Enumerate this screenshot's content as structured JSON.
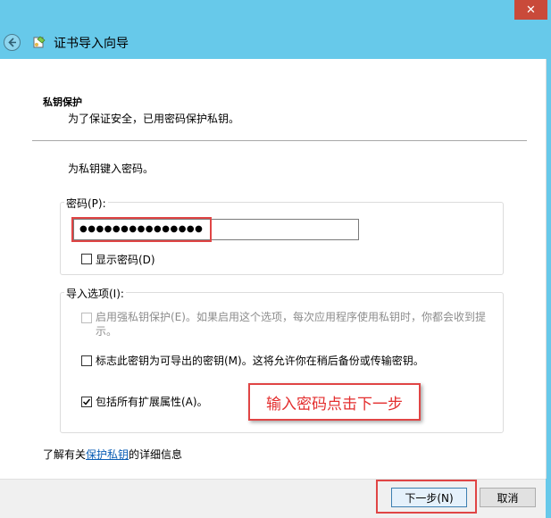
{
  "window": {
    "close_glyph": "✕",
    "title": "证书导入向导",
    "back_icon": "back-arrow-icon",
    "wizard_icon": "certificate-wizard-icon"
  },
  "section": {
    "heading": "私钥保护",
    "description": "为了保证安全，已用密码保护私钥。"
  },
  "prompt": "为私钥键入密码。",
  "password": {
    "label": "密码(P):",
    "value": "●●●●●●●●●●●●●●●",
    "show_label": "显示密码(D)",
    "show_checked": false
  },
  "import_options": {
    "label": "导入选项(I):",
    "options": [
      {
        "label": "启用强私钥保护(E)。如果启用这个选项，每次应用程序使用私钥时，你都会收到提示。",
        "checked": false,
        "enabled": false
      },
      {
        "label": "标志此密钥为可导出的密钥(M)。这将允许你在稍后备份或传输密钥。",
        "checked": false,
        "enabled": true
      },
      {
        "label": "包括所有扩展属性(A)。",
        "checked": true,
        "enabled": true
      }
    ]
  },
  "annotation": "输入密码点击下一步",
  "learn_more": {
    "prefix": "了解有关",
    "link": "保护私钥",
    "suffix": "的详细信息"
  },
  "buttons": {
    "next": "下一步(N)",
    "cancel": "取消"
  },
  "colors": {
    "titlebar": "#67c9ea",
    "annotation_red": "#e04545",
    "link": "#0b5eb5"
  }
}
